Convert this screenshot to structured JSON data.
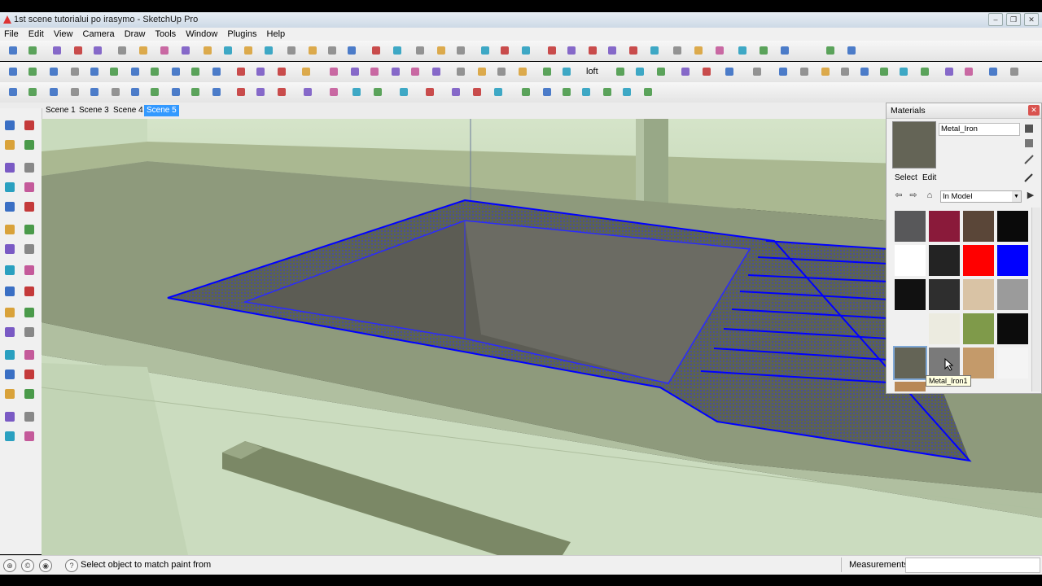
{
  "window": {
    "title": "1st scene tutorialui po irasymo - SketchUp Pro"
  },
  "menu": [
    "File",
    "Edit",
    "View",
    "Camera",
    "Draw",
    "Tools",
    "Window",
    "Plugins",
    "Help"
  ],
  "scenes": [
    "Scene 1",
    "Scene 3",
    "Scene 4",
    "Scene 5"
  ],
  "active_scene": "Scene 5",
  "toolbar": {
    "loft_label": "loft"
  },
  "materials": {
    "title": "Materials",
    "current_name": "Metal_Iron",
    "tabs": {
      "select": "Select",
      "edit": "Edit"
    },
    "library": "In Model",
    "tooltip": "Metal_Iron1",
    "swatch_colors": [
      "#58585a",
      "#8a1a3a",
      "#5a4638",
      "#0a0a0a",
      "#ffffff",
      "#232323",
      "#ff0000",
      "#0000ff",
      "#111111",
      "#2e2e2e",
      "#d9c3a5",
      "#9b9b9b",
      "#f0f0f0",
      "#ecebe0",
      "#7f9a4a",
      "#0c0c0c",
      "#646456",
      "#7a7a7a",
      "#c49a6a",
      "#f4f4f4",
      "#b88856"
    ]
  },
  "status": {
    "message": "Select object to match paint from",
    "measurements_label": "Measurements"
  },
  "colors": {
    "selection_edge": "#0000ff",
    "wall": "#cfe0c3",
    "counter_top": "#8f9a7d"
  }
}
